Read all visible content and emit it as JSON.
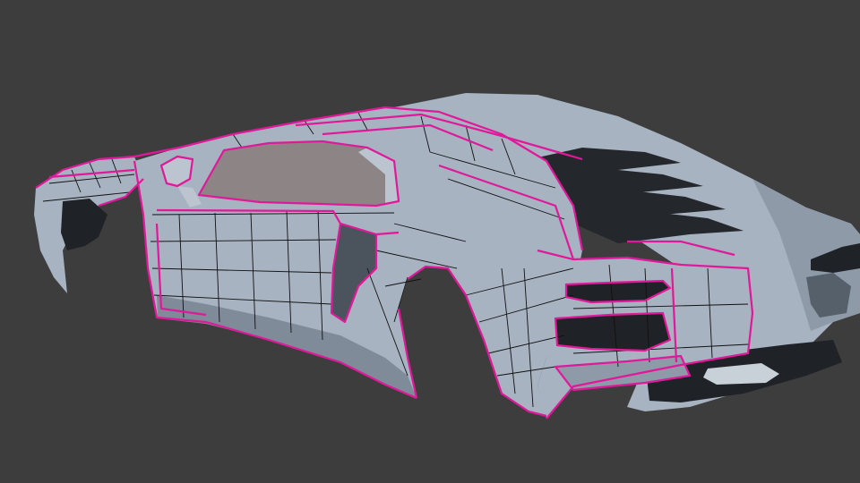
{
  "viewport": {
    "background_color": "#3d3d3d",
    "view_mode": "3d-viewport-mesh-edit"
  },
  "model": {
    "object": "sports-car-body-mesh",
    "body_color": "#a7b3c1",
    "body_shadow_color": "#7f8b99",
    "glass_color": "#8d8585",
    "dark_part_color": "#1f2226",
    "selected_edge_color": "#e0189a",
    "wire_edge_color": "#111111",
    "selection_state": "faces-selected"
  }
}
